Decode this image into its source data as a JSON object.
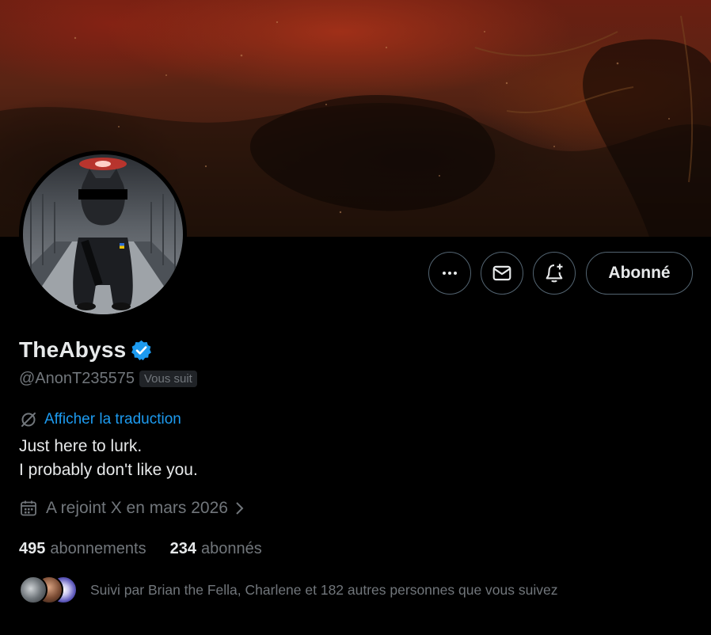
{
  "profile": {
    "display_name": "TheAbyss",
    "handle": "@AnonT235575",
    "follows_you_badge": "Vous suit",
    "verified": true,
    "translate_link": "Afficher la traduction",
    "bio_lines": [
      "Just here to lurk.",
      "I probably don't like you."
    ],
    "joined": "A rejoint X en mars 2026",
    "following_count": "495",
    "following_label": "abonnements",
    "followers_count": "234",
    "followers_label": "abonnés",
    "followed_by": "Suivi par Brian the Fella, Charlene et 182 autres personnes que vous suivez"
  },
  "actions": {
    "more_icon": "more-horizontal-icon",
    "message_icon": "envelope-icon",
    "notify_icon": "bell-plus-icon",
    "follow_label": "Abonné"
  },
  "colors": {
    "background": "#000000",
    "text_primary": "#e7e9ea",
    "text_secondary": "#71767b",
    "link": "#1d9bf0",
    "verified": "#1d9bf0",
    "border": "#536471"
  }
}
